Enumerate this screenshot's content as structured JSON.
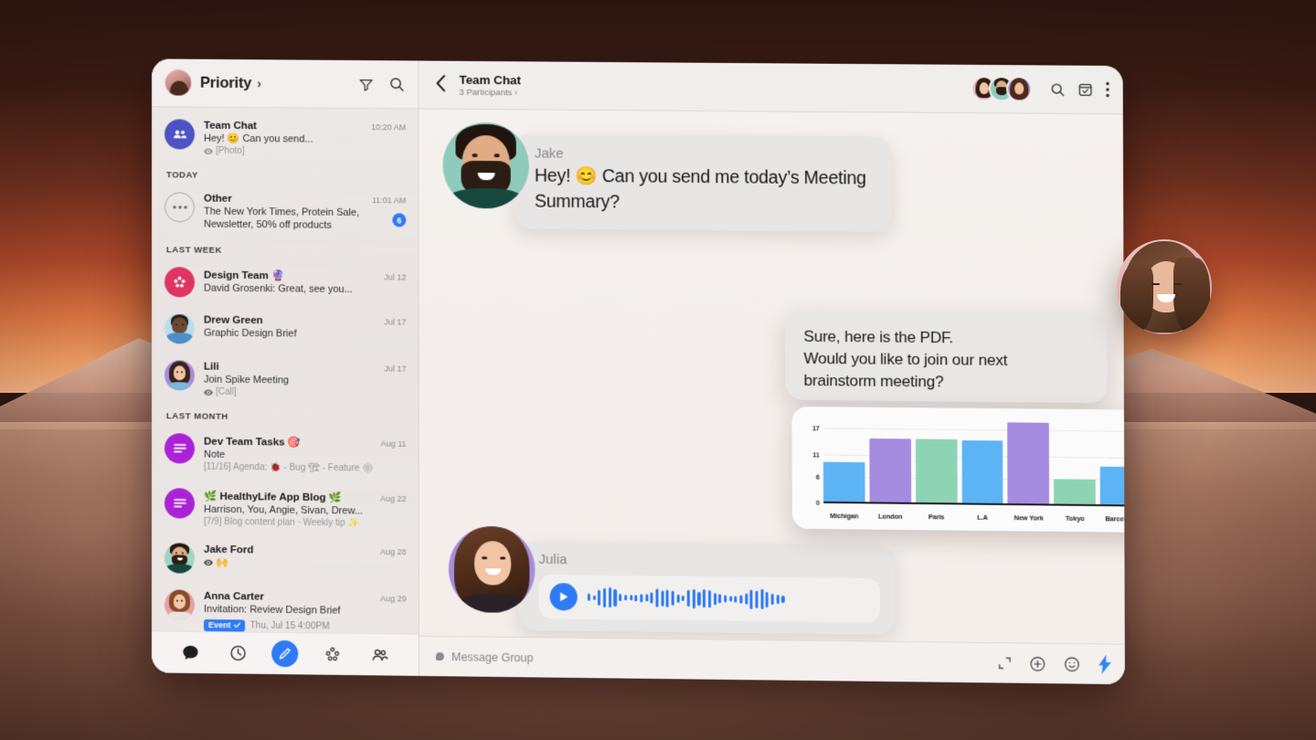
{
  "sidebar": {
    "header": {
      "title": "Priority",
      "chevron": "›",
      "filter_icon": "filter-icon",
      "search_icon": "search-icon"
    },
    "sections": [
      {
        "label": "",
        "items": [
          {
            "name": "Team Chat",
            "preview": "Hey! 😊 Can you send...",
            "sub": "[Photo]",
            "time": "10:20 AM",
            "avatar": "group",
            "badge": ""
          }
        ]
      },
      {
        "label": "TODAY",
        "items": [
          {
            "name": "Other",
            "preview": "The New York Times, Protein Sale, Newsletter, 50% off products",
            "sub": "",
            "time": "11:01 AM",
            "avatar": "other",
            "badge": "6"
          }
        ]
      },
      {
        "label": "LAST WEEK",
        "items": [
          {
            "name": "Design Team 🔮",
            "preview": "David Grosenki: Great, see you...",
            "sub": "",
            "time": "Jul 12",
            "avatar": "design",
            "badge": ""
          },
          {
            "name": "Drew Green",
            "preview": "Graphic Design Brief",
            "sub": "",
            "time": "Jul 17",
            "avatar": "drew",
            "badge": ""
          },
          {
            "name": "Lili",
            "preview": "Join Spike Meeting",
            "sub": "[Call]",
            "time": "Jul 17",
            "avatar": "lili",
            "badge": ""
          }
        ]
      },
      {
        "label": "LAST MONTH",
        "items": [
          {
            "name": "Dev Team Tasks 🎯",
            "preview": "Note",
            "sub": "[11/16] Agenda:  🐞 - Bug 🏗 - Feature ⚙",
            "time": "Aug 11",
            "avatar": "note",
            "badge": ""
          },
          {
            "name": "🌿 HealthyLife App Blog 🌿",
            "preview": "Harrison, You, Angie, Sivan, Drew...",
            "sub": "[7/9] Blog content plan · Weekly tip ✨",
            "time": "Aug 22",
            "avatar": "note",
            "badge": ""
          },
          {
            "name": "Jake Ford",
            "preview": "🙌",
            "sub": "",
            "time": "Aug 28",
            "avatar": "jake",
            "badge": ""
          },
          {
            "name": "Anna Carter",
            "preview": "Invitation: Review Design Brief",
            "sub": "Thu, Jul 15  4:00PM",
            "chip": "Event",
            "time": "Aug 29",
            "avatar": "anna",
            "badge": ""
          }
        ]
      }
    ],
    "tabs": [
      {
        "name": "chat-tab",
        "icon": "chat-bubble-icon",
        "active": true
      },
      {
        "name": "recent-tab",
        "icon": "clock-icon",
        "active": false
      },
      {
        "name": "compose-tab",
        "icon": "pencil-icon",
        "active": true
      },
      {
        "name": "groups-tab",
        "icon": "cluster-icon",
        "active": false
      },
      {
        "name": "contacts-tab",
        "icon": "people-icon",
        "active": false
      }
    ]
  },
  "chat": {
    "back_icon": "back-chevron-icon",
    "title": "Team Chat",
    "subtitle": "3 Participants",
    "subtitle_chevron": "›",
    "header_icons": [
      "search-icon",
      "archive-check-icon",
      "more-vertical-icon"
    ],
    "messages": [
      {
        "type": "text",
        "sender": "Jake",
        "text": "Hey! 😊 Can you send me today’s Meeting Summary?"
      },
      {
        "type": "attachment",
        "text_line1": "Sure, here is the PDF.",
        "text_line2": "Would you like to join our next",
        "text_line3": "brainstorm meeting?"
      },
      {
        "type": "voice",
        "sender": "Julia",
        "play_icon": "play-icon"
      }
    ],
    "read_receipt_icon": "eye-icon",
    "composer": {
      "placeholder": "Message Group",
      "icons": [
        "expand-icon",
        "plus-circle-icon",
        "emoji-icon",
        "lightning-icon"
      ]
    }
  },
  "chart_data": {
    "type": "bar",
    "title": "",
    "xlabel": "",
    "ylabel": "",
    "categories": [
      "Michigan",
      "London",
      "Paris",
      "L.A",
      "New York",
      "Tokyo",
      "Barcelona"
    ],
    "values": [
      9.5,
      15.0,
      15.0,
      14.8,
      19.0,
      6.1,
      9.0
    ],
    "colors": [
      "#5db4f5",
      "#a58ce0",
      "#8ed4b4",
      "#5db4f5",
      "#a58ce0",
      "#8ed4b4",
      "#5db4f5"
    ],
    "yticks": [
      0,
      6,
      11,
      17
    ],
    "ylim": [
      0,
      20
    ],
    "grid": true,
    "legend": "none"
  },
  "colors": {
    "accent": "#2f7bf6",
    "read_badge": "#1fc04a",
    "bar_blue": "#5db4f5",
    "bar_purple": "#a58ce0",
    "bar_green": "#8ed4b4",
    "window_bg": "#f1eeec",
    "bubble_bg": "#e8e6e4"
  }
}
